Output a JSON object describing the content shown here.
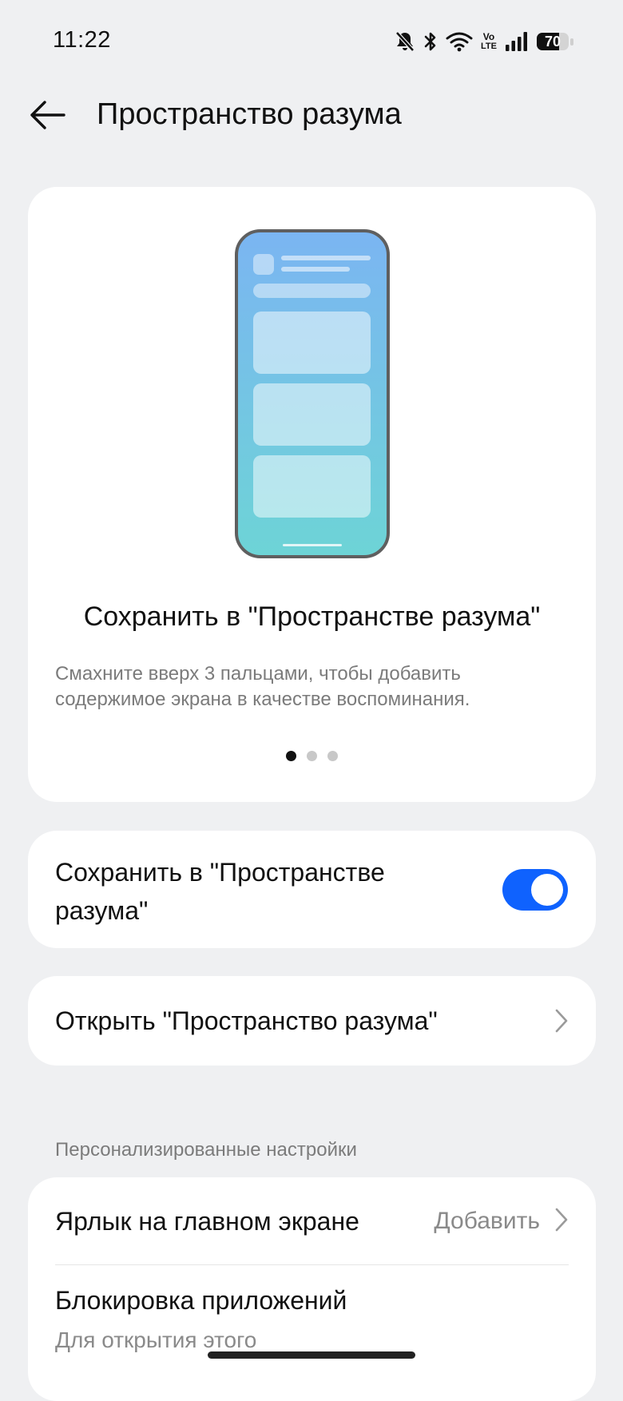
{
  "status_bar": {
    "time": "11:22",
    "battery_level": 70,
    "battery_text": "70",
    "icons": [
      "mute-bell-icon",
      "bluetooth-icon",
      "wifi-icon",
      "volte-icon",
      "signal-icon",
      "battery-icon"
    ],
    "volte_top": "Vo",
    "volte_bottom": "LTE"
  },
  "header": {
    "title": "Пространство разума",
    "back_icon": "arrow-left-icon"
  },
  "hero": {
    "title": "Сохранить в \"Пространстве разума\"",
    "description": "Смахните вверх 3 пальцами, чтобы добавить содержимое экрана в качестве воспоминания.",
    "page_count": 3,
    "active_page": 1,
    "colors": {
      "phone_top": "#7cb6f1",
      "phone_bottom": "#6fd3d9",
      "phone_frame": "#5f5f5f"
    }
  },
  "toggle_row": {
    "label": "Сохранить в \"Пространстве разума\"",
    "enabled": true,
    "accent": "#0f62fe"
  },
  "open_row": {
    "label": "Открыть \"Пространство разума\""
  },
  "personalized": {
    "section_title": "Персонализированные настройки",
    "shortcut_label": "Ярлык на главном экране",
    "shortcut_value": "Добавить",
    "app_lock_label": "Блокировка приложений",
    "app_lock_desc": "Для открытия этого"
  }
}
